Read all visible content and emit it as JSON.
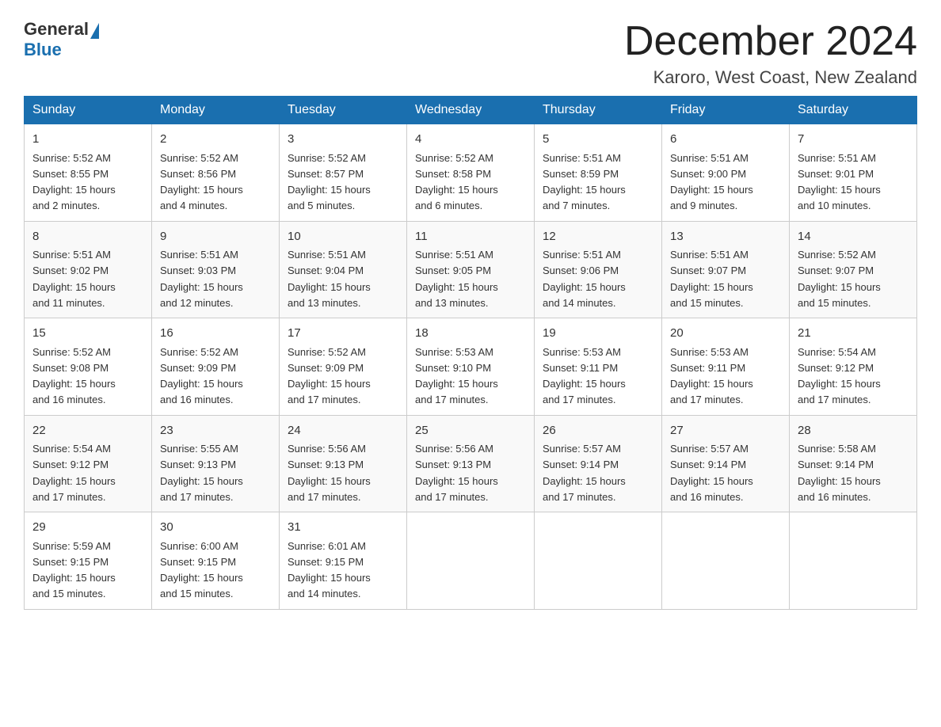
{
  "header": {
    "logo_general": "General",
    "logo_blue": "Blue",
    "month_title": "December 2024",
    "location": "Karoro, West Coast, New Zealand"
  },
  "days_of_week": [
    "Sunday",
    "Monday",
    "Tuesday",
    "Wednesday",
    "Thursday",
    "Friday",
    "Saturday"
  ],
  "weeks": [
    [
      {
        "num": "1",
        "sunrise": "5:52 AM",
        "sunset": "8:55 PM",
        "daylight": "15 hours and 2 minutes."
      },
      {
        "num": "2",
        "sunrise": "5:52 AM",
        "sunset": "8:56 PM",
        "daylight": "15 hours and 4 minutes."
      },
      {
        "num": "3",
        "sunrise": "5:52 AM",
        "sunset": "8:57 PM",
        "daylight": "15 hours and 5 minutes."
      },
      {
        "num": "4",
        "sunrise": "5:52 AM",
        "sunset": "8:58 PM",
        "daylight": "15 hours and 6 minutes."
      },
      {
        "num": "5",
        "sunrise": "5:51 AM",
        "sunset": "8:59 PM",
        "daylight": "15 hours and 7 minutes."
      },
      {
        "num": "6",
        "sunrise": "5:51 AM",
        "sunset": "9:00 PM",
        "daylight": "15 hours and 9 minutes."
      },
      {
        "num": "7",
        "sunrise": "5:51 AM",
        "sunset": "9:01 PM",
        "daylight": "15 hours and 10 minutes."
      }
    ],
    [
      {
        "num": "8",
        "sunrise": "5:51 AM",
        "sunset": "9:02 PM",
        "daylight": "15 hours and 11 minutes."
      },
      {
        "num": "9",
        "sunrise": "5:51 AM",
        "sunset": "9:03 PM",
        "daylight": "15 hours and 12 minutes."
      },
      {
        "num": "10",
        "sunrise": "5:51 AM",
        "sunset": "9:04 PM",
        "daylight": "15 hours and 13 minutes."
      },
      {
        "num": "11",
        "sunrise": "5:51 AM",
        "sunset": "9:05 PM",
        "daylight": "15 hours and 13 minutes."
      },
      {
        "num": "12",
        "sunrise": "5:51 AM",
        "sunset": "9:06 PM",
        "daylight": "15 hours and 14 minutes."
      },
      {
        "num": "13",
        "sunrise": "5:51 AM",
        "sunset": "9:07 PM",
        "daylight": "15 hours and 15 minutes."
      },
      {
        "num": "14",
        "sunrise": "5:52 AM",
        "sunset": "9:07 PM",
        "daylight": "15 hours and 15 minutes."
      }
    ],
    [
      {
        "num": "15",
        "sunrise": "5:52 AM",
        "sunset": "9:08 PM",
        "daylight": "15 hours and 16 minutes."
      },
      {
        "num": "16",
        "sunrise": "5:52 AM",
        "sunset": "9:09 PM",
        "daylight": "15 hours and 16 minutes."
      },
      {
        "num": "17",
        "sunrise": "5:52 AM",
        "sunset": "9:09 PM",
        "daylight": "15 hours and 17 minutes."
      },
      {
        "num": "18",
        "sunrise": "5:53 AM",
        "sunset": "9:10 PM",
        "daylight": "15 hours and 17 minutes."
      },
      {
        "num": "19",
        "sunrise": "5:53 AM",
        "sunset": "9:11 PM",
        "daylight": "15 hours and 17 minutes."
      },
      {
        "num": "20",
        "sunrise": "5:53 AM",
        "sunset": "9:11 PM",
        "daylight": "15 hours and 17 minutes."
      },
      {
        "num": "21",
        "sunrise": "5:54 AM",
        "sunset": "9:12 PM",
        "daylight": "15 hours and 17 minutes."
      }
    ],
    [
      {
        "num": "22",
        "sunrise": "5:54 AM",
        "sunset": "9:12 PM",
        "daylight": "15 hours and 17 minutes."
      },
      {
        "num": "23",
        "sunrise": "5:55 AM",
        "sunset": "9:13 PM",
        "daylight": "15 hours and 17 minutes."
      },
      {
        "num": "24",
        "sunrise": "5:56 AM",
        "sunset": "9:13 PM",
        "daylight": "15 hours and 17 minutes."
      },
      {
        "num": "25",
        "sunrise": "5:56 AM",
        "sunset": "9:13 PM",
        "daylight": "15 hours and 17 minutes."
      },
      {
        "num": "26",
        "sunrise": "5:57 AM",
        "sunset": "9:14 PM",
        "daylight": "15 hours and 17 minutes."
      },
      {
        "num": "27",
        "sunrise": "5:57 AM",
        "sunset": "9:14 PM",
        "daylight": "15 hours and 16 minutes."
      },
      {
        "num": "28",
        "sunrise": "5:58 AM",
        "sunset": "9:14 PM",
        "daylight": "15 hours and 16 minutes."
      }
    ],
    [
      {
        "num": "29",
        "sunrise": "5:59 AM",
        "sunset": "9:15 PM",
        "daylight": "15 hours and 15 minutes."
      },
      {
        "num": "30",
        "sunrise": "6:00 AM",
        "sunset": "9:15 PM",
        "daylight": "15 hours and 15 minutes."
      },
      {
        "num": "31",
        "sunrise": "6:01 AM",
        "sunset": "9:15 PM",
        "daylight": "15 hours and 14 minutes."
      },
      null,
      null,
      null,
      null
    ]
  ],
  "labels": {
    "sunrise": "Sunrise:",
    "sunset": "Sunset:",
    "daylight": "Daylight:"
  }
}
